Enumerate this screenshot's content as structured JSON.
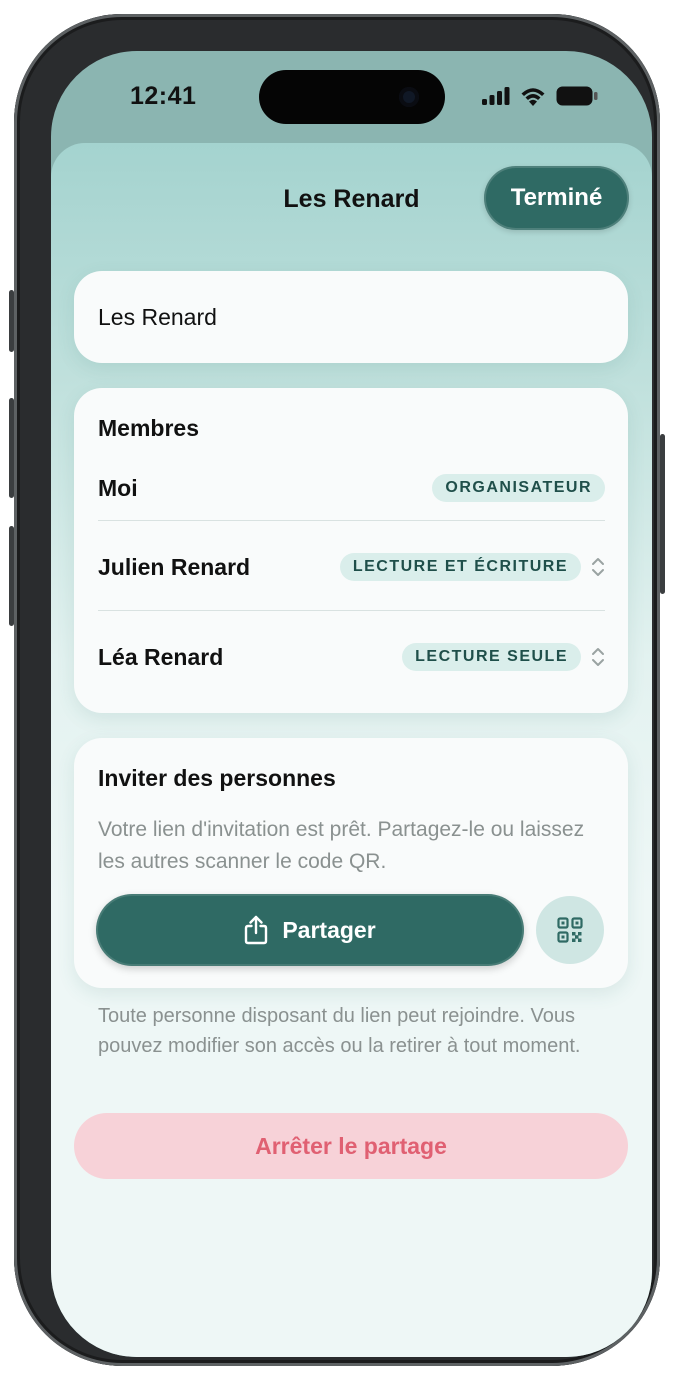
{
  "status_bar": {
    "time": "12:41",
    "icons": [
      "signal-icon",
      "wifi-icon",
      "battery-icon"
    ]
  },
  "header": {
    "title": "Les Renard",
    "done_label": "Terminé"
  },
  "group_name": {
    "value": "Les Renard"
  },
  "members": {
    "title": "Membres",
    "items": [
      {
        "name": "Moi",
        "role": "ORGANISATEUR",
        "editable": false
      },
      {
        "name": "Julien Renard",
        "role": "LECTURE ET ÉCRITURE",
        "editable": true
      },
      {
        "name": "Léa Renard",
        "role": "LECTURE SEULE",
        "editable": true
      }
    ]
  },
  "invite": {
    "title": "Inviter des personnes",
    "description": "Votre lien d'invitation est prêt. Partagez-le ou laissez les autres scanner le code QR.",
    "share_label": "Partager",
    "share_icon": "share-icon",
    "qr_icon": "qr-code-icon"
  },
  "footnote": "Toute personne disposant du lien peut rejoindre. Vous pouvez modifier son accès ou la retirer à tout moment.",
  "stop_sharing_label": "Arrêter le partage",
  "colors": {
    "accent": "#2f6a64",
    "badge_bg": "#daeeeb",
    "danger_text": "#e06072",
    "danger_bg": "#f7d2d8"
  }
}
